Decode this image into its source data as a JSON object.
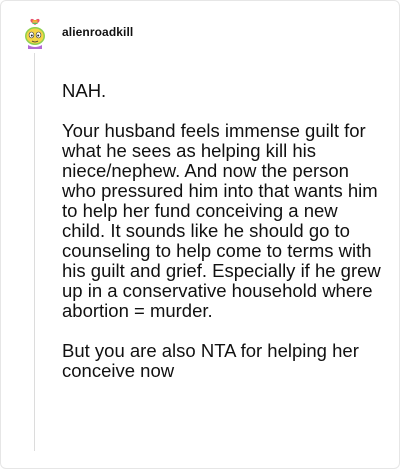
{
  "post": {
    "username": "alienroadkill",
    "avatar_icon": "alien-avatar-icon",
    "paragraphs": [
      "NAH.",
      "Your husband feels immense guilt for what he sees as helping kill his niece/nephew. And now the person who pressured him into that wants him to help her fund conceiving a new child. It sounds like he should go to counseling to help come to terms with his guilt and grief. Especially if he grew up in a conservative household where abortion = murder.",
      "But you are also NTA for helping her conceive now"
    ]
  },
  "colors": {
    "text": "#111111",
    "thread_line": "#dcdcdc",
    "avatar_green": "#8fd14f",
    "avatar_yellow": "#f5d547",
    "heart_pink": "#e8536b"
  }
}
